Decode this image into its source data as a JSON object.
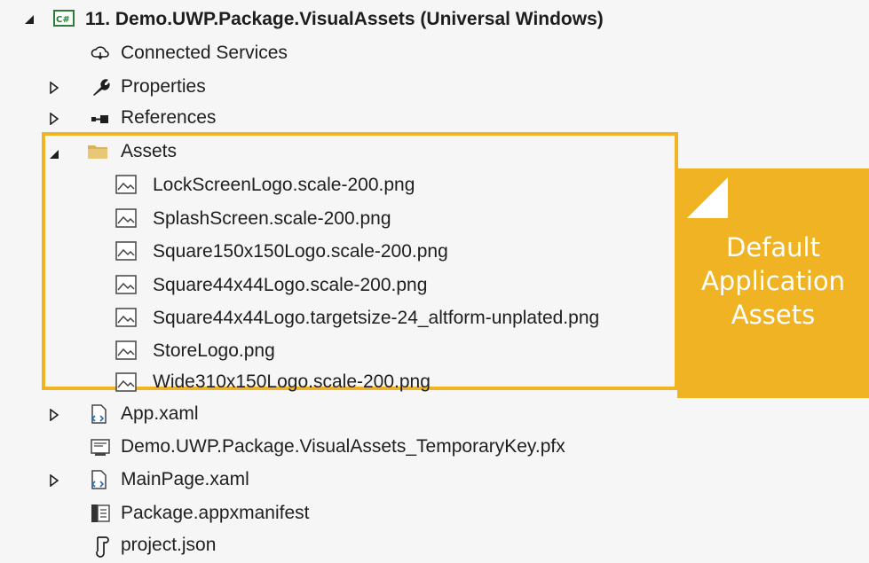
{
  "project": {
    "title": "11. Demo.UWP.Package.VisualAssets (Universal Windows)",
    "icon": "csharp-project-icon"
  },
  "items": {
    "connected_services": "Connected Services",
    "properties": "Properties",
    "references": "References",
    "assets": "Assets",
    "app_xaml": "App.xaml",
    "temp_key": "Demo.UWP.Package.VisualAssets_TemporaryKey.pfx",
    "mainpage_xaml": "MainPage.xaml",
    "manifest": "Package.appxmanifest",
    "project_json": "project.json"
  },
  "asset_files": [
    "LockScreenLogo.scale-200.png",
    "SplashScreen.scale-200.png",
    "Square150x150Logo.scale-200.png",
    "Square44x44Logo.scale-200.png",
    "Square44x44Logo.targetsize-24_altform-unplated.png",
    "StoreLogo.png",
    "Wide310x150Logo.scale-200.png"
  ],
  "callout": {
    "line1": "Default",
    "line2": "Application",
    "line3": "Assets"
  },
  "colors": {
    "accent": "#f0b323",
    "background": "#f6f6f6",
    "text": "#1e1e1e"
  }
}
